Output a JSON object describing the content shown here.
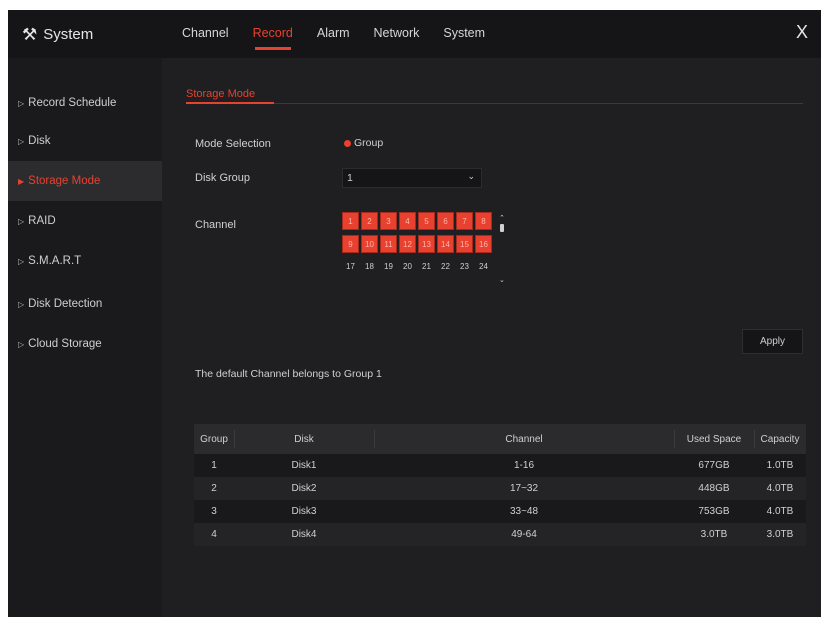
{
  "app": {
    "title": "System",
    "close_label": "X"
  },
  "tabs": [
    {
      "label": "Channel"
    },
    {
      "label": "Record"
    },
    {
      "label": "Alarm"
    },
    {
      "label": "Network"
    },
    {
      "label": "System"
    }
  ],
  "sidebar": {
    "items": [
      {
        "label": "Record Schedule"
      },
      {
        "label": "Disk"
      },
      {
        "label": "Storage Mode"
      },
      {
        "label": "RAID"
      },
      {
        "label": "S.M.A.R.T"
      },
      {
        "label": "Disk Detection"
      },
      {
        "label": "Cloud Storage"
      }
    ],
    "active_index": 2
  },
  "main": {
    "subtab_label": "Storage Mode",
    "mode_selection": {
      "label": "Mode Selection",
      "option": "Group"
    },
    "disk_group": {
      "label": "Disk Group",
      "value": "1"
    },
    "channel": {
      "label": "Channel",
      "grid": [
        [
          {
            "n": "1",
            "on": true
          },
          {
            "n": "2",
            "on": true
          },
          {
            "n": "3",
            "on": true
          },
          {
            "n": "4",
            "on": true
          },
          {
            "n": "5",
            "on": true
          },
          {
            "n": "6",
            "on": true
          },
          {
            "n": "7",
            "on": true
          },
          {
            "n": "8",
            "on": true
          }
        ],
        [
          {
            "n": "9",
            "on": true
          },
          {
            "n": "10",
            "on": true
          },
          {
            "n": "11",
            "on": true
          },
          {
            "n": "12",
            "on": true
          },
          {
            "n": "13",
            "on": true
          },
          {
            "n": "14",
            "on": true
          },
          {
            "n": "15",
            "on": true
          },
          {
            "n": "16",
            "on": true
          }
        ],
        [
          {
            "n": "17",
            "on": false
          },
          {
            "n": "18",
            "on": false
          },
          {
            "n": "19",
            "on": false
          },
          {
            "n": "20",
            "on": false
          },
          {
            "n": "21",
            "on": false
          },
          {
            "n": "22",
            "on": false
          },
          {
            "n": "23",
            "on": false
          },
          {
            "n": "24",
            "on": false
          }
        ]
      ]
    },
    "apply_label": "Apply",
    "note": "The default Channel belongs to Group 1",
    "table": {
      "headers": [
        "Group",
        "Disk",
        "Channel",
        "Used Space",
        "Capacity"
      ],
      "rows": [
        [
          "1",
          "Disk1",
          "1-16",
          "677GB",
          "1.0TB"
        ],
        [
          "2",
          "Disk2",
          "17~32",
          "448GB",
          "4.0TB"
        ],
        [
          "3",
          "Disk3",
          "33~48",
          "753GB",
          "4.0TB"
        ],
        [
          "4",
          "Disk4",
          "49-64",
          "3.0TB",
          "3.0TB"
        ]
      ]
    }
  },
  "colors": {
    "accent": "#e8412f",
    "background": "#1f1f21",
    "sidebar": "#1a1a1c"
  },
  "icons": {
    "app": "tools-icon",
    "close": "close-icon",
    "tree_arrow": "triangle-right-icon",
    "dropdown": "chevron-down-icon"
  }
}
